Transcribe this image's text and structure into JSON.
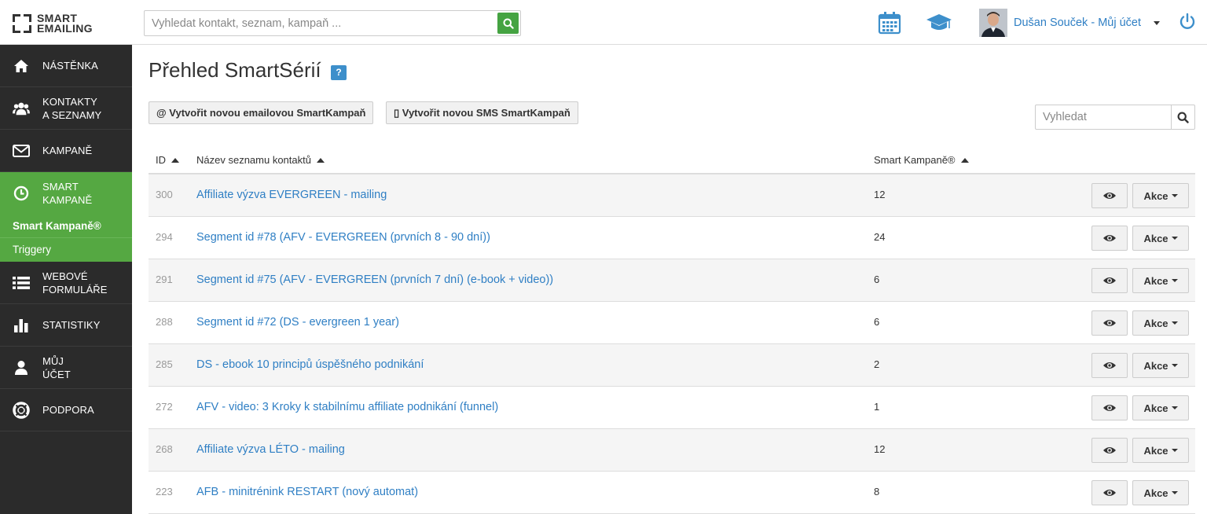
{
  "logo": {
    "line1": "SMART",
    "line2": "EMAILING"
  },
  "header": {
    "search_placeholder": "Vyhledat kontakt, seznam, kampaň ...",
    "user_name": "Dušan Souček - Můj účet"
  },
  "sidebar": {
    "items": [
      {
        "label": "NÁSTĚNKA",
        "icon": "home-icon"
      },
      {
        "label": "KONTAKTY A SEZNAMY",
        "icon": "users-icon"
      },
      {
        "label": "KAMPANĚ",
        "icon": "envelope-icon"
      },
      {
        "label": "SMART KAMPANĚ",
        "icon": "clock-icon"
      },
      {
        "label": "WEBOVÉ FORMULÁŘE",
        "icon": "list-icon"
      },
      {
        "label": "STATISTIKY",
        "icon": "bar-chart-icon"
      },
      {
        "label": "MŮJ ÚČET",
        "icon": "user-icon"
      },
      {
        "label": "PODPORA",
        "icon": "lifebuoy-icon"
      }
    ],
    "subitems": [
      "Smart Kampaně®",
      "Triggery"
    ]
  },
  "main": {
    "title": "Přehled SmartSérií",
    "help": "?",
    "btn_email": "@ Vytvořit novou emailovou SmartKampaň",
    "btn_sms": "▯ Vytvořit novou SMS SmartKampaň",
    "table_search_placeholder": "Vyhledat",
    "columns": {
      "id": "ID",
      "name": "Název seznamu kontaktů",
      "count": "Smart Kampaně®"
    },
    "action_label": "Akce",
    "rows": [
      {
        "id": "300",
        "name": "Affiliate výzva EVERGREEN - mailing",
        "count": "12"
      },
      {
        "id": "294",
        "name": "Segment id #78 (AFV - EVERGREEN (prvních 8 - 90 dní))",
        "count": "24"
      },
      {
        "id": "291",
        "name": "Segment id #75 (AFV - EVERGREEN (prvních 7 dní) (e-book + video))",
        "count": "6"
      },
      {
        "id": "288",
        "name": "Segment id #72 (DS - evergreen 1 year)",
        "count": "6"
      },
      {
        "id": "285",
        "name": "DS - ebook 10 principů úspěšného podnikání",
        "count": "2"
      },
      {
        "id": "272",
        "name": "AFV - video: 3 Kroky k stabilnímu affiliate podnikání (funnel)",
        "count": "1"
      },
      {
        "id": "268",
        "name": "Affiliate výzva LÉTO - mailing",
        "count": "12"
      },
      {
        "id": "223",
        "name": "AFB - minitrénink RESTART (nový automat)",
        "count": "8"
      }
    ]
  },
  "colors": {
    "accent_green": "#55a842",
    "link_blue": "#2f7fc4",
    "sidebar_dark": "#2b2b2b"
  }
}
